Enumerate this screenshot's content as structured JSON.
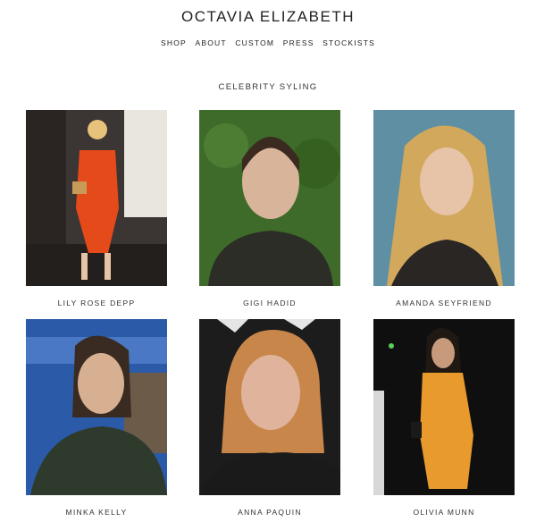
{
  "header": {
    "brand": "OCTAVIA ELIZABETH",
    "nav": [
      "SHOP",
      "ABOUT",
      "CUSTOM",
      "PRESS",
      "STOCKISTS"
    ]
  },
  "main": {
    "section_title": "CELEBRITY SYLING",
    "gallery": [
      {
        "name": "LILY ROSE DEPP"
      },
      {
        "name": "GIGI HADID"
      },
      {
        "name": "AMANDA SEYFRIEND"
      },
      {
        "name": "MINKA KELLY"
      },
      {
        "name": "ANNA PAQUIN"
      },
      {
        "name": "OLIVIA MUNN"
      }
    ]
  }
}
